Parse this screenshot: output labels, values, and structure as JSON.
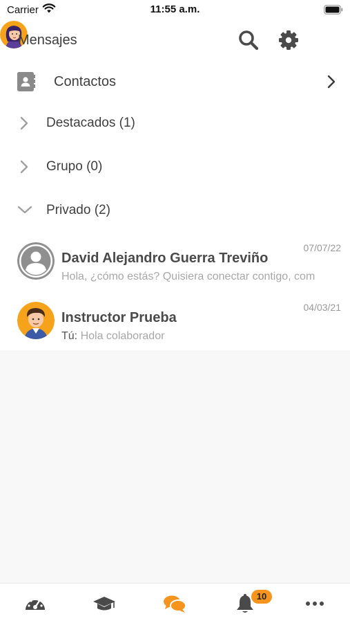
{
  "status_bar": {
    "carrier": "Carrier",
    "time": "11:55 a.m."
  },
  "header": {
    "title": "Mensajes",
    "icons": [
      "search-icon",
      "gear-icon",
      "user-avatar"
    ]
  },
  "contacts": {
    "label": "Contactos",
    "icon": "address-book-icon"
  },
  "groups": [
    {
      "label": "Destacados (1)",
      "expanded": false
    },
    {
      "label": "Grupo (0)",
      "expanded": false
    },
    {
      "label": "Privado (2)",
      "expanded": true
    }
  ],
  "conversations": [
    {
      "name": "David Alejandro Guerra Treviño",
      "date": "07/07/22",
      "prefix": "",
      "preview": "Hola, ¿cómo estás? Quisiera conectar contigo, com",
      "avatar": "default-user-avatar"
    },
    {
      "name": "Instructor Prueba",
      "date": "04/03/21",
      "prefix": "Tú:",
      "preview": "Hola colaborador",
      "avatar": "instructor-avatar"
    }
  ],
  "tabbar": {
    "tabs": [
      "dashboard-icon",
      "graduation-cap-icon",
      "chat-bubbles-icon",
      "bell-icon",
      "more-icon"
    ],
    "active_tab": "chat-bubbles-icon",
    "notifications_badge": "10"
  },
  "colors": {
    "accent": "#f7941d",
    "icon_gray": "#4a4a4a",
    "background": "#f8f8f8"
  }
}
